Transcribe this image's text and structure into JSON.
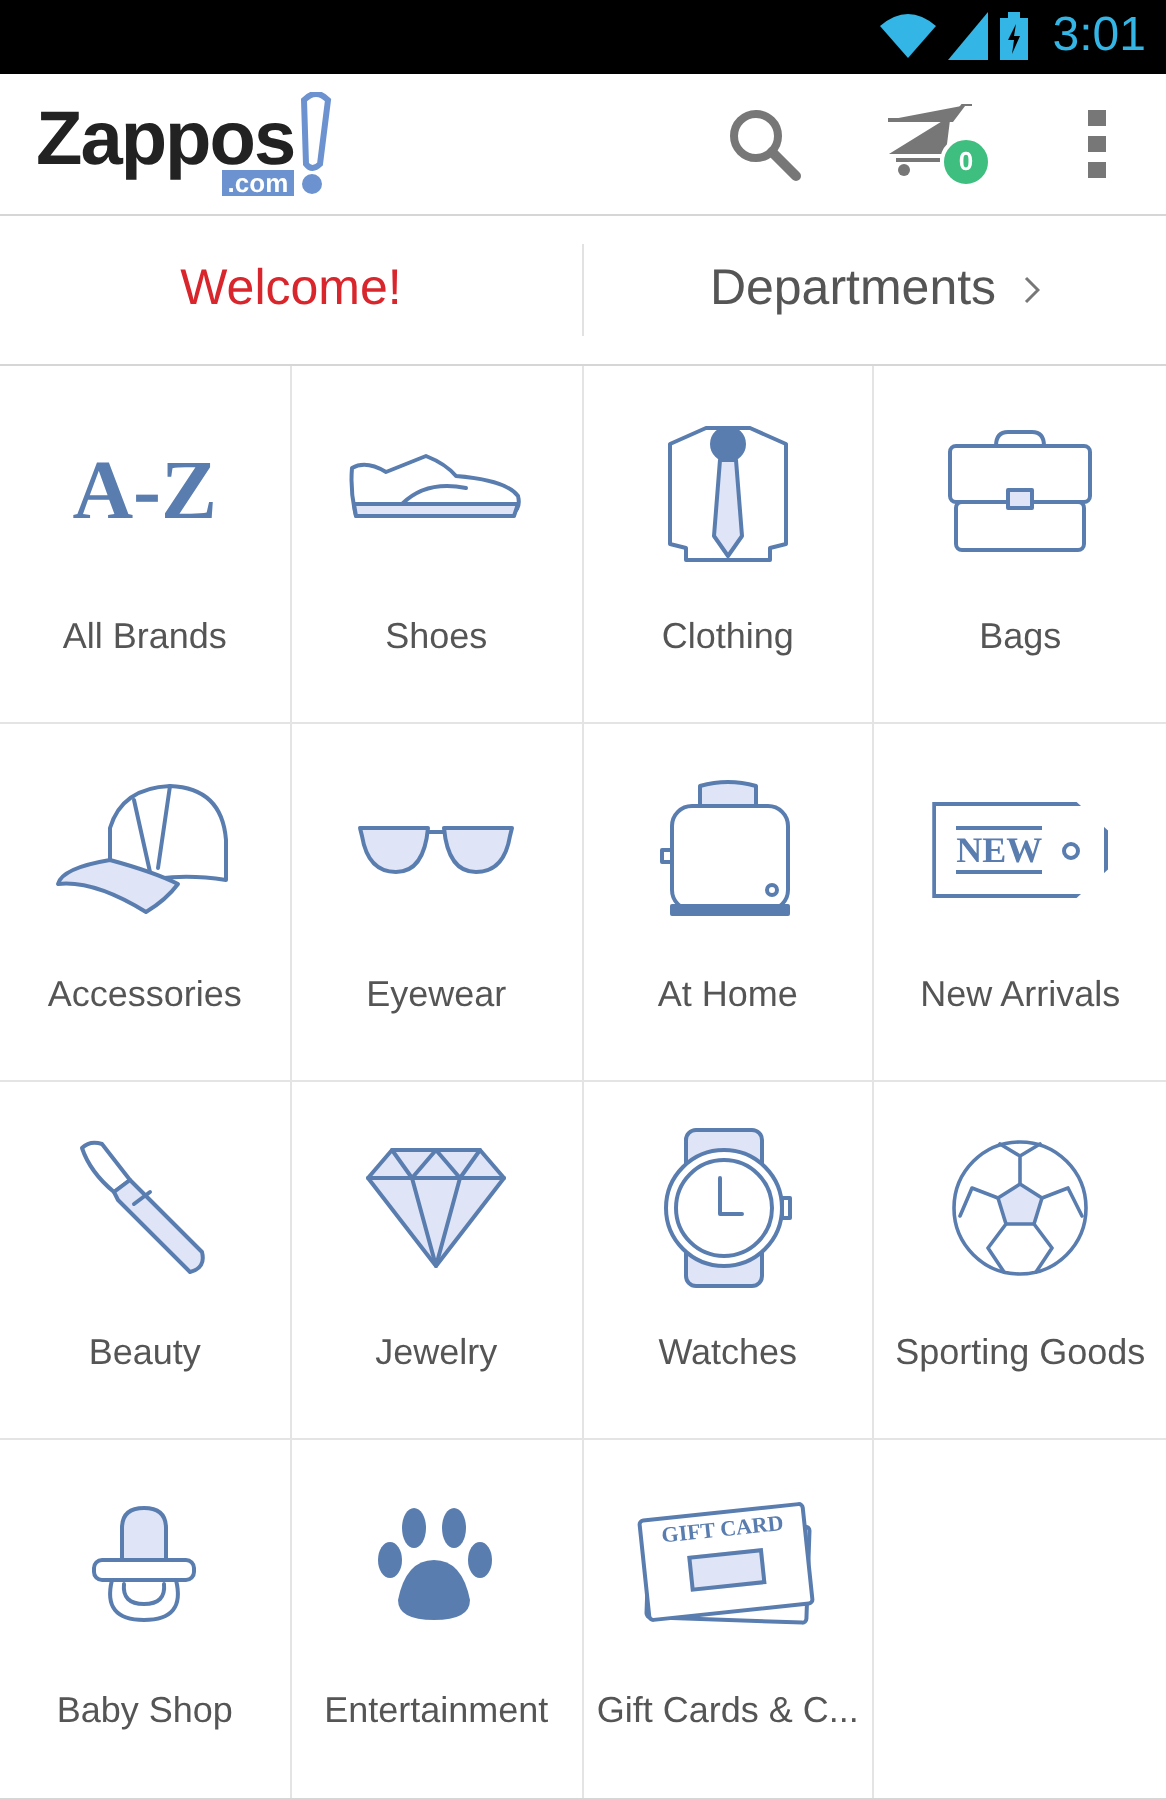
{
  "status_bar": {
    "time": "3:01"
  },
  "action_bar": {
    "logo": {
      "name": "Zappos",
      "suffix": ".com"
    },
    "cart_count": "0"
  },
  "nav": {
    "welcome": "Welcome!",
    "departments": "Departments"
  },
  "categories": [
    {
      "kind": "brands",
      "label": "All Brands",
      "icon_text": "A-Z"
    },
    {
      "kind": "shoe",
      "label": "Shoes"
    },
    {
      "kind": "shirt",
      "label": "Clothing"
    },
    {
      "kind": "bag",
      "label": "Bags"
    },
    {
      "kind": "cap",
      "label": "Accessories"
    },
    {
      "kind": "glasses",
      "label": "Eyewear"
    },
    {
      "kind": "toaster",
      "label": "At Home"
    },
    {
      "kind": "tag",
      "label": "New Arrivals",
      "icon_text": "NEW"
    },
    {
      "kind": "lipstick",
      "label": "Beauty"
    },
    {
      "kind": "diamond",
      "label": "Jewelry"
    },
    {
      "kind": "watch",
      "label": "Watches"
    },
    {
      "kind": "ball",
      "label": "Sporting Goods"
    },
    {
      "kind": "pacifier",
      "label": "Baby Shop"
    },
    {
      "kind": "paw",
      "label": "Entertainment"
    },
    {
      "kind": "giftcard",
      "label": "Gift Cards & C...",
      "icon_text": "GIFT CARD"
    }
  ]
}
